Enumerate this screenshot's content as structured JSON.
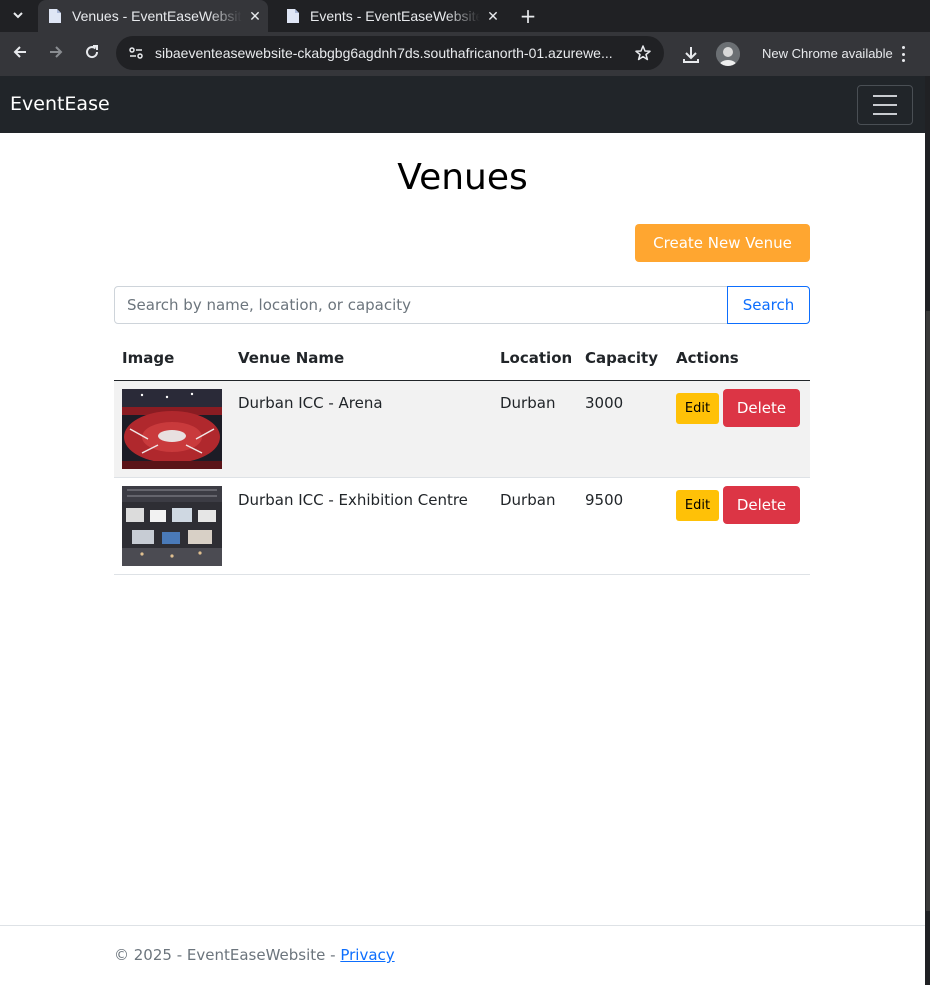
{
  "browser": {
    "tabs": [
      {
        "title": "Venues - EventEaseWebsite",
        "active": true
      },
      {
        "title": "Events - EventEaseWebsite",
        "active": false
      }
    ],
    "url": "sibaeventeasewebsite-ckabgbg6agdnh7ds.southafricanorth-01.azurewe...",
    "update_label": "New Chrome available"
  },
  "navbar": {
    "brand": "EventEase"
  },
  "page": {
    "title": "Venues",
    "create_label": "Create New Venue",
    "search_placeholder": "Search by name, location, or capacity",
    "search_label": "Search"
  },
  "table": {
    "headers": [
      "Image",
      "Venue Name",
      "Location",
      "Capacity",
      "Actions"
    ],
    "rows": [
      {
        "name": "Durban ICC - Arena",
        "location": "Durban",
        "capacity": "3000",
        "image": "arena photo"
      },
      {
        "name": "Durban ICC - Exhibition Centre",
        "location": "Durban",
        "capacity": "9500",
        "image": "exhibition hall photo"
      }
    ],
    "edit_label": "Edit",
    "delete_label": "Delete"
  },
  "footer": {
    "text": "© 2025 - EventEaseWebsite - ",
    "link": "Privacy"
  },
  "colors": {
    "navbar_bg": "#212529",
    "create_button": "#ffa630",
    "search_button": "#0d6efd",
    "edit_button": "#ffc107",
    "delete_button": "#dc3545"
  }
}
